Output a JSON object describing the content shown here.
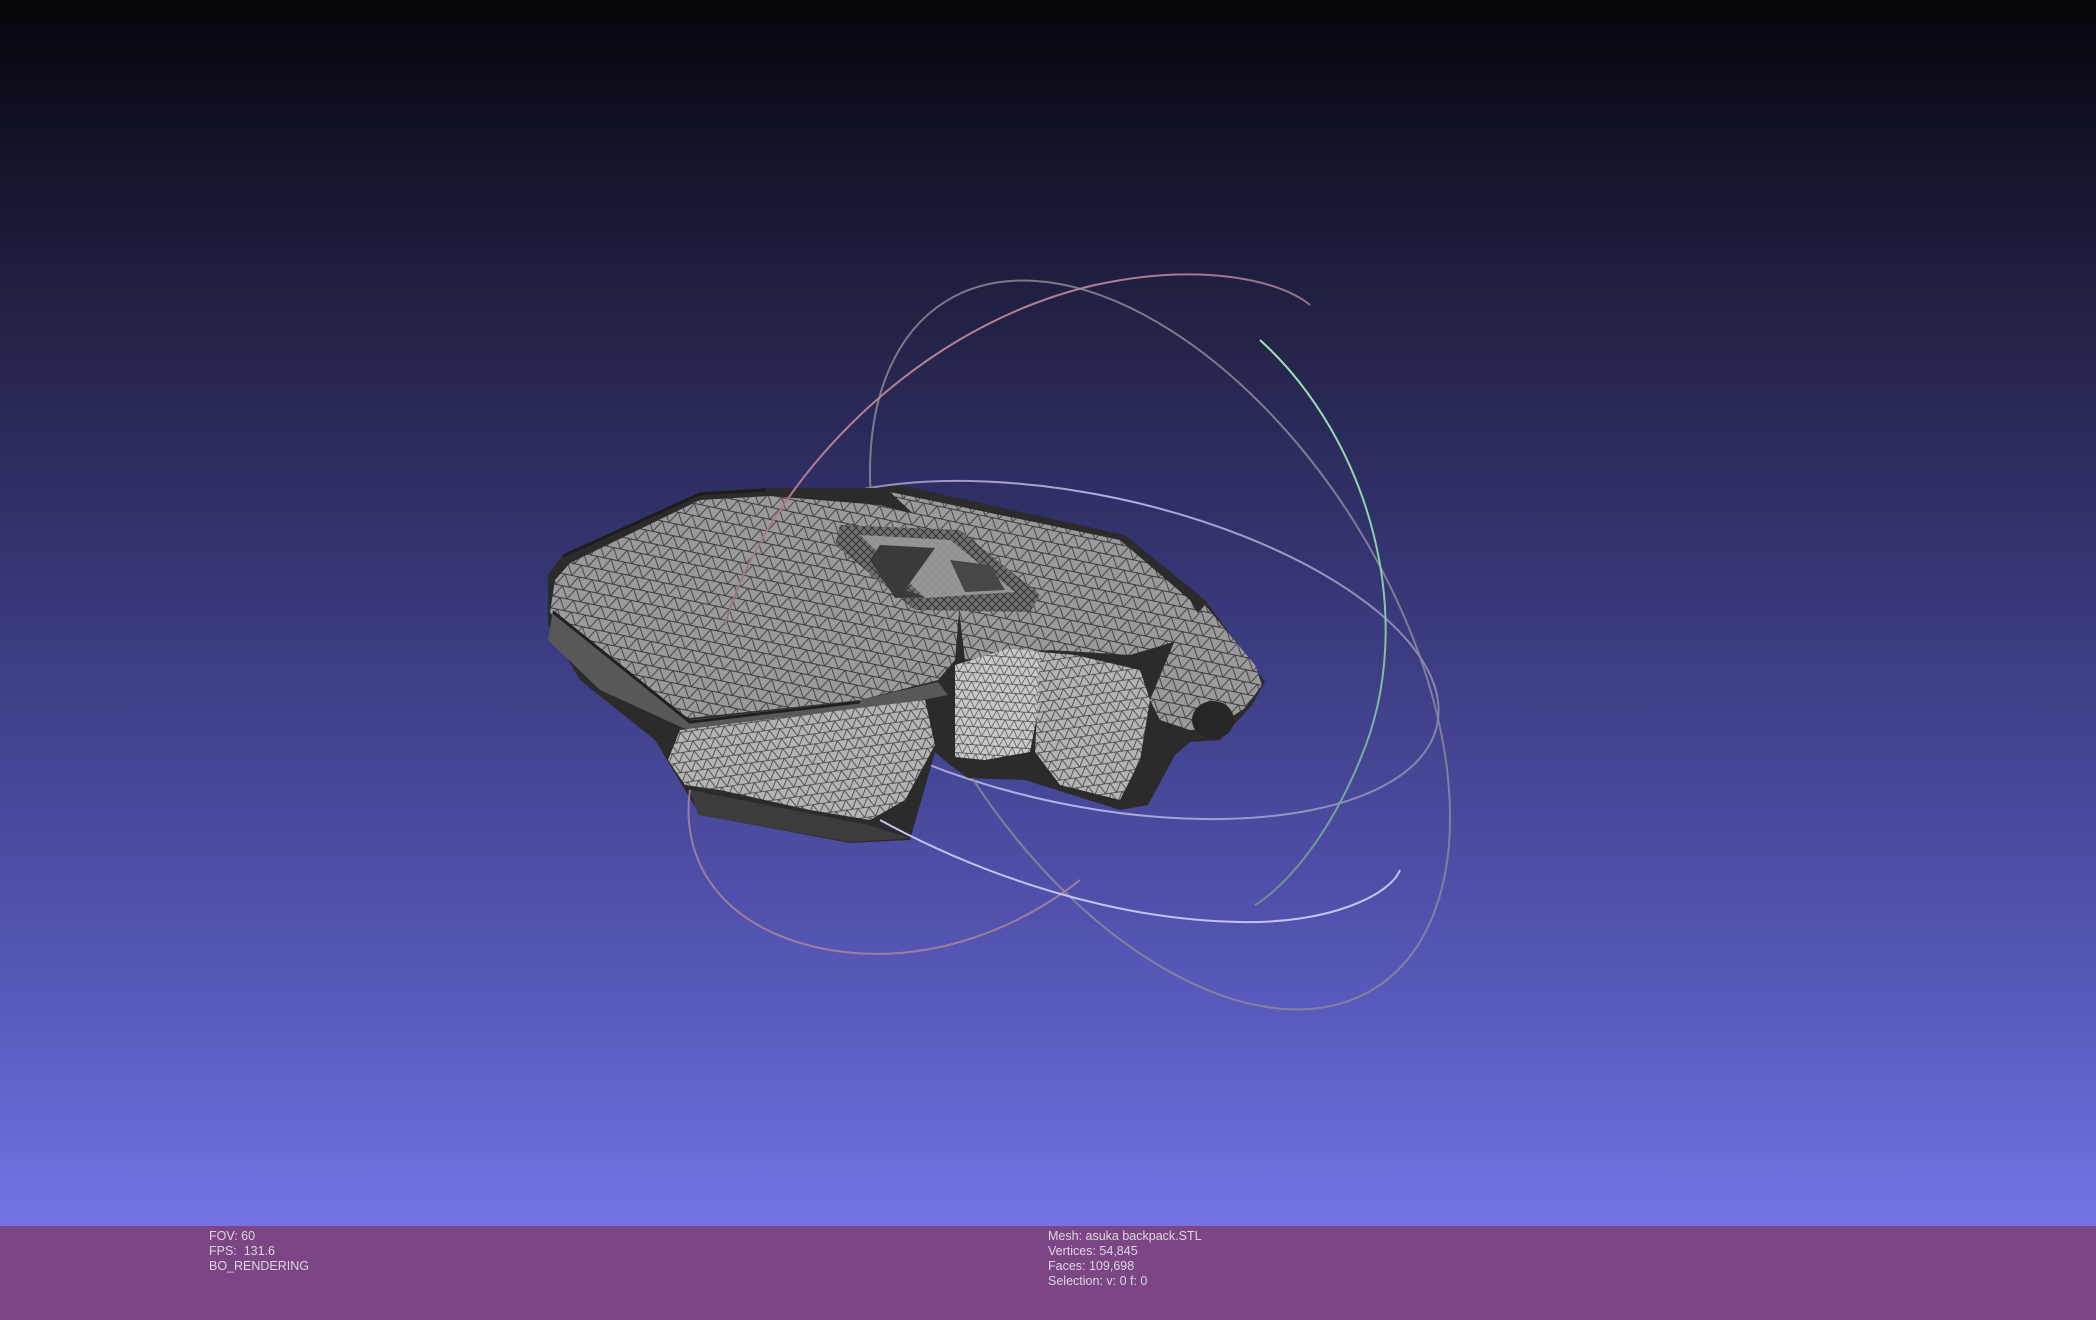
{
  "viewer": {
    "fov_line": "FOV: 60",
    "fps_line": "FPS:  131.6",
    "render_mode": "BO_RENDERING"
  },
  "mesh": {
    "name_line": "Mesh: asuka backpack.STL",
    "vertices_line": "Vertices: 54,845",
    "faces_line": "Faces: 109,698",
    "selection_line": "Selection: v: 0 f: 0"
  },
  "colors": {
    "background_top": "#05050a",
    "background_bottom": "#7373e6",
    "info_bar": "#7c4584",
    "mesh_fill": "#8c8c8c",
    "wireframe": "#3a3a3a",
    "trackball_x": "#e39aaa",
    "trackball_y": "#9ee6b5",
    "trackball_z": "#b3b3ee"
  },
  "icons": {
    "trackball": "trackball-rings-icon",
    "model": "mesh-model"
  }
}
